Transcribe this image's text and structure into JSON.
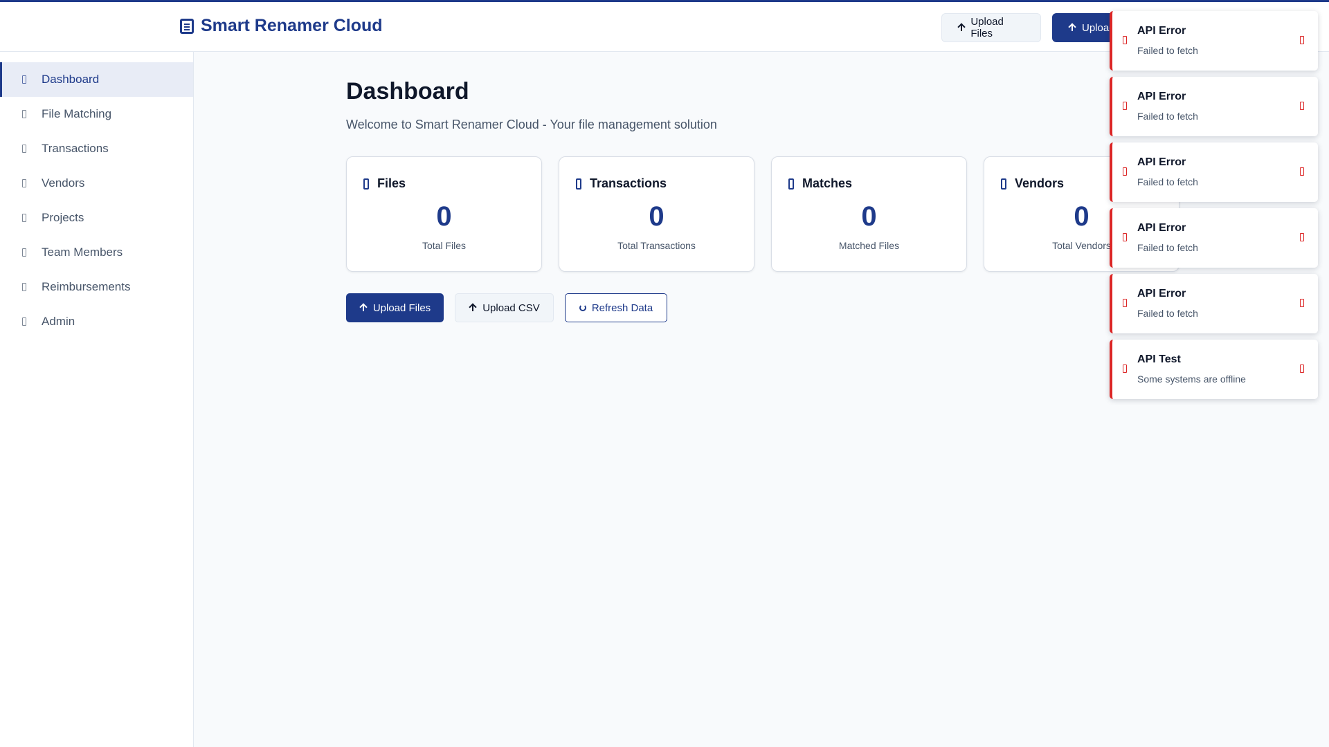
{
  "app": {
    "title": "Smart Renamer Cloud"
  },
  "header": {
    "upload_files_label": "Upload Files",
    "upload_label": "Upload"
  },
  "sidebar": {
    "items": [
      {
        "label": "Dashboard",
        "active": true
      },
      {
        "label": "File Matching"
      },
      {
        "label": "Transactions"
      },
      {
        "label": "Vendors"
      },
      {
        "label": "Projects"
      },
      {
        "label": "Team Members"
      },
      {
        "label": "Reimbursements"
      },
      {
        "label": "Admin"
      }
    ]
  },
  "main": {
    "title": "Dashboard",
    "subtitle": "Welcome to Smart Renamer Cloud - Your file management solution",
    "cards": [
      {
        "title": "Files",
        "value": "0",
        "caption": "Total Files",
        "icon": "file-icon"
      },
      {
        "title": "Transactions",
        "value": "0",
        "caption": "Total Transactions",
        "icon": "receipt-icon"
      },
      {
        "title": "Matches",
        "value": "0",
        "caption": "Matched Files",
        "icon": "link-icon"
      },
      {
        "title": "Vendors",
        "value": "0",
        "caption": "Total Vendors",
        "icon": "building-icon"
      }
    ],
    "actions": {
      "upload_files_label": "Upload Files",
      "upload_csv_label": "Upload CSV",
      "refresh_label": "Refresh Data"
    }
  },
  "toasts": [
    {
      "title": "API Error",
      "message": "Failed to fetch"
    },
    {
      "title": "API Error",
      "message": "Failed to fetch"
    },
    {
      "title": "API Error",
      "message": "Failed to fetch"
    },
    {
      "title": "API Error",
      "message": "Failed to fetch"
    },
    {
      "title": "API Error",
      "message": "Failed to fetch"
    },
    {
      "title": "API Test",
      "message": "Some systems are offline"
    }
  ],
  "colors": {
    "brand": "#1e3a8a",
    "error": "#dc2626",
    "background": "#f8fafc"
  }
}
